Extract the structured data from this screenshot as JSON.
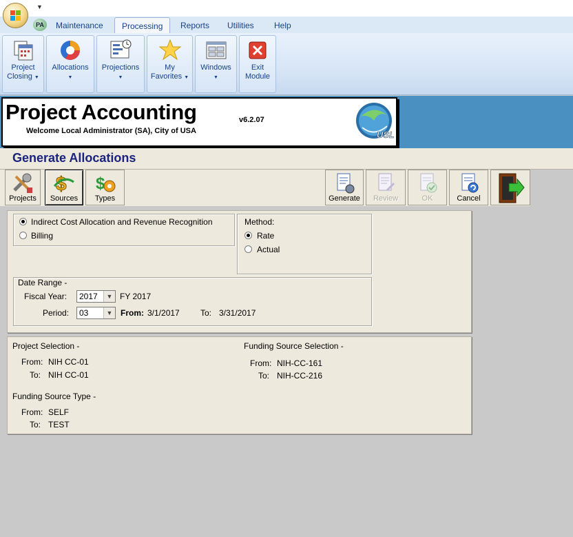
{
  "ribbon": {
    "tabs": [
      "Maintenance",
      "Processing",
      "Reports",
      "Utilities",
      "Help"
    ],
    "active_tab": "Processing",
    "pa_badge": "PA",
    "buttons": {
      "project_closing": [
        "Project",
        "Closing"
      ],
      "allocations": "Allocations",
      "projections": "Projections",
      "my_favorites": [
        "My",
        "Favorites"
      ],
      "windows": "Windows",
      "exit_module": [
        "Exit",
        "Module"
      ]
    }
  },
  "header": {
    "title": "Project Accounting",
    "welcome": "Welcome Local Administrator (SA), City of USA",
    "version": "v6.2.07",
    "logo_text": "USL"
  },
  "page": {
    "title": "Generate Allocations"
  },
  "toolbar": {
    "projects": "Projects",
    "sources": "Sources",
    "types": "Types",
    "generate": "Generate",
    "review": "Review",
    "ok": "OK",
    "cancel": "Cancel"
  },
  "options": {
    "allocation_type": {
      "choices": [
        "Indirect Cost Allocation and Revenue Recognition",
        "Billing"
      ],
      "selected": "Indirect Cost Allocation and Revenue Recognition"
    },
    "method": {
      "label": "Method:",
      "choices": [
        "Rate",
        "Actual"
      ],
      "selected": "Rate"
    },
    "date_range": {
      "label": "Date Range -",
      "fiscal_year_label": "Fiscal Year:",
      "fiscal_year_value": "2017",
      "fiscal_year_text": "FY 2017",
      "period_label": "Period:",
      "period_value": "03",
      "from_label": "From:",
      "from_value": "3/1/2017",
      "to_label": "To:",
      "to_value": "3/31/2017"
    }
  },
  "selection": {
    "project": {
      "label": "Project Selection -",
      "from_label": "From:",
      "from": "NIH CC-01",
      "to_label": "To:",
      "to": "NIH CC-01"
    },
    "funding_source": {
      "label": "Funding Source Selection -",
      "from_label": "From:",
      "from": "NIH-CC-161",
      "to_label": "To:",
      "to": "NIH-CC-216"
    },
    "funding_source_type": {
      "label": "Funding Source Type -",
      "from_label": "From:",
      "from": "SELF",
      "to_label": "To:",
      "to": "TEST"
    }
  },
  "colors": {
    "ribbon_text": "#15428b",
    "page_title": "#1a237e",
    "panel_bg": "#ede9dc",
    "banner_blue": "#4a90c0"
  }
}
